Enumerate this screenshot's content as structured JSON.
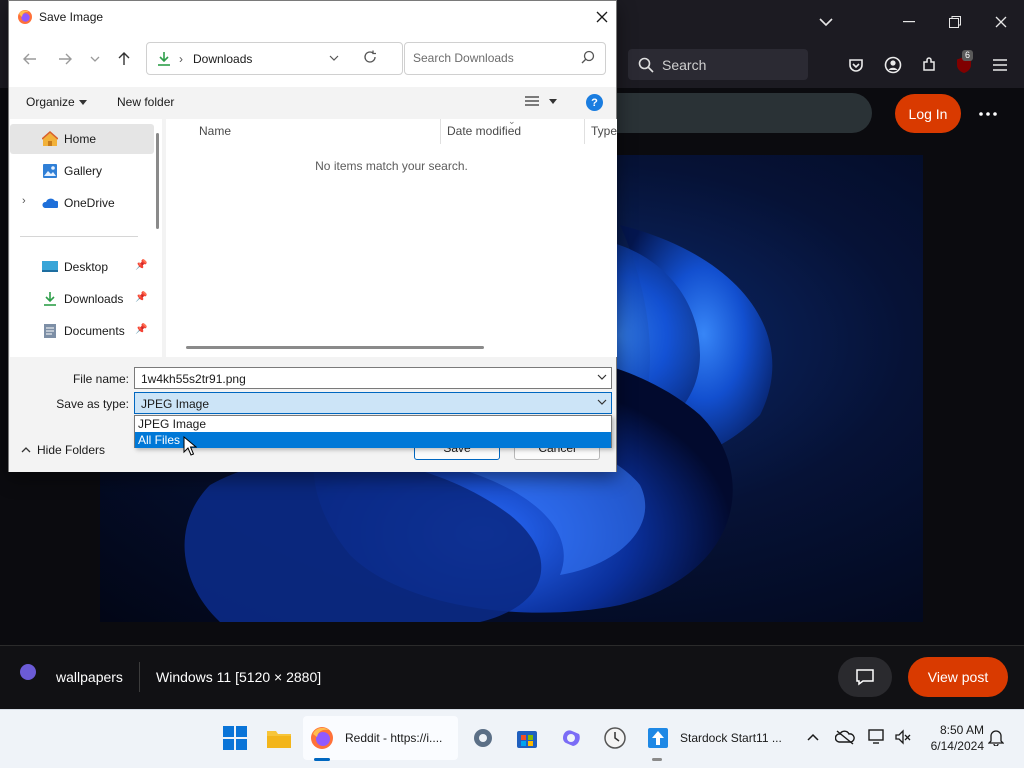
{
  "browser": {
    "search_placeholder": "Search",
    "extension_badge": "6",
    "login_label": "Log In"
  },
  "post": {
    "subreddit": "wallpapers",
    "title": "Windows 11 [5120 × 2880]",
    "view_post_label": "View post"
  },
  "dialog": {
    "title": "Save Image",
    "address": {
      "location": "Downloads"
    },
    "search": {
      "placeholder": "Search Downloads"
    },
    "commands": {
      "organize": "Organize",
      "new_folder": "New folder"
    },
    "nav_pane": {
      "items": [
        {
          "label": "Home",
          "icon": "home-icon",
          "selected": true
        },
        {
          "label": "Gallery",
          "icon": "gallery-icon"
        },
        {
          "label": "OneDrive",
          "icon": "onedrive-icon",
          "expandable": true
        },
        {
          "label": "Desktop",
          "icon": "desktop-icon",
          "pinned": true
        },
        {
          "label": "Downloads",
          "icon": "downloads-icon",
          "pinned": true
        },
        {
          "label": "Documents",
          "icon": "documents-icon",
          "pinned": true
        }
      ]
    },
    "columns": [
      "Name",
      "Date modified",
      "Type"
    ],
    "empty_message": "No items match your search.",
    "file_name_label": "File name:",
    "file_name_value": "1w4kh55s2tr91.png",
    "save_as_type_label": "Save as type:",
    "save_as_type_value": "JPEG Image",
    "type_options": [
      "JPEG Image",
      "All Files"
    ],
    "highlighted_option": "All Files",
    "hide_folders_label": "Hide Folders",
    "save_label": "Save",
    "cancel_label": "Cancel"
  },
  "taskbar": {
    "firefox_label": "Reddit - https://i....",
    "stardock_label": "Stardock Start11 ...",
    "time": "8:50 AM",
    "date": "6/14/2024"
  },
  "colors": {
    "reddit_orange": "#d93a00",
    "windows_accent": "#0067c0",
    "selection_blue": "#0078d7"
  }
}
